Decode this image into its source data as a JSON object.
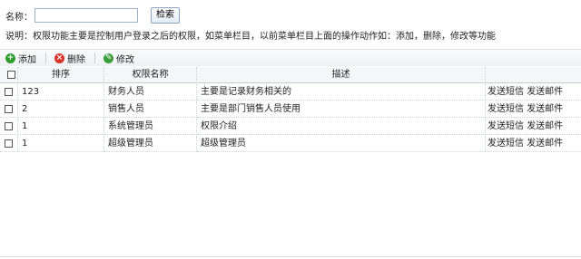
{
  "search": {
    "label": "名称：",
    "value": "",
    "placeholder": "",
    "button": "检索"
  },
  "description": "说明：权限功能主要是控制用户登录之后的权限，如菜单栏目，以前菜单栏目上面的操作动作如：添加，删除，修改等功能",
  "toolbar": {
    "add": {
      "label": "添加",
      "icon": "plus-icon",
      "color": "#2e9e2e"
    },
    "delete": {
      "label": "删除",
      "icon": "delete-icon",
      "color": "#d9332b"
    },
    "edit": {
      "label": "修改",
      "icon": "edit-icon",
      "color": "#3c9e3c"
    }
  },
  "table": {
    "headers": {
      "sort": "排序",
      "name": "权限名称",
      "desc": "描述",
      "ops": ""
    },
    "rows": [
      {
        "sort": "123",
        "name": "财务人员",
        "desc": "主要是记录财务相关的",
        "op1": "发送短信",
        "op2": "发送邮件"
      },
      {
        "sort": "2",
        "name": "销售人员",
        "desc": "主要是部门销售人员使用",
        "op1": "发送短信",
        "op2": "发送邮件"
      },
      {
        "sort": "1",
        "name": "系统管理员",
        "desc": "权限介绍",
        "op1": "发送短信",
        "op2": "发送邮件"
      },
      {
        "sort": "1",
        "name": "超级管理员",
        "desc": "超级管理员",
        "op1": "发送短信",
        "op2": "发送邮件"
      }
    ]
  }
}
